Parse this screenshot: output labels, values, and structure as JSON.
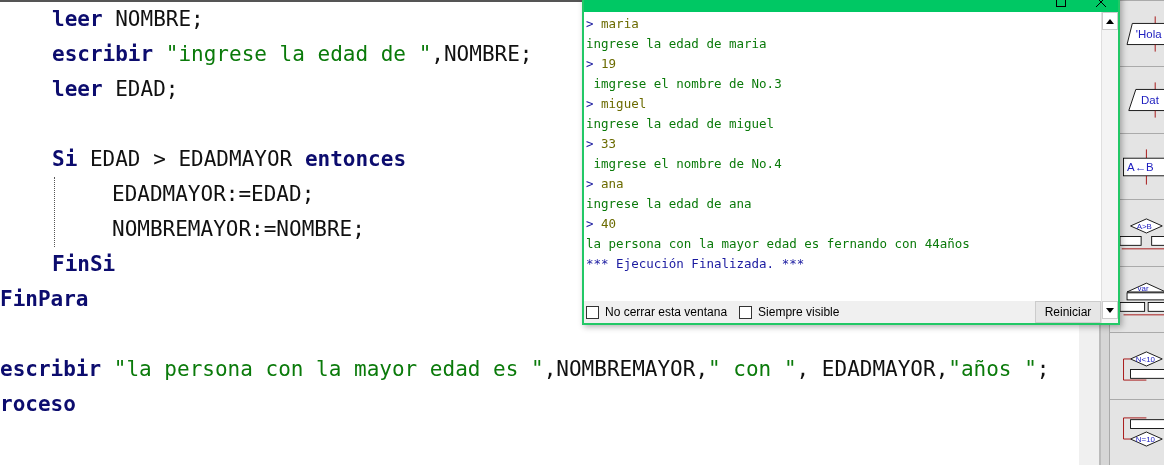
{
  "editor": {
    "lines": [
      {
        "children": [
          {
            "tokens": [
              {
                "kind": "keyword",
                "text": "leer"
              },
              {
                "kind": "plain",
                "text": " NOMBRE;"
              }
            ]
          },
          {
            "tokens": [
              {
                "kind": "keyword",
                "text": "escribir "
              },
              {
                "kind": "string",
                "text": "\"ingrese la edad de \""
              },
              {
                "kind": "plain",
                "text": ",NOMBRE;"
              }
            ]
          },
          {
            "tokens": [
              {
                "kind": "keyword",
                "text": "leer"
              },
              {
                "kind": "plain",
                "text": " EDAD;"
              }
            ]
          },
          {
            "blank_before": true,
            "tokens": [
              {
                "kind": "keyword",
                "text": "Si"
              },
              {
                "kind": "plain",
                "text": " EDAD > EDADMAYOR "
              },
              {
                "kind": "keyword",
                "text": "entonces"
              }
            ],
            "children": [
              {
                "tokens": [
                  {
                    "kind": "plain",
                    "text": "EDADMAYOR:=EDAD;"
                  }
                ]
              },
              {
                "tokens": [
                  {
                    "kind": "plain",
                    "text": "NOMBREMAYOR:=NOMBRE;"
                  }
                ]
              }
            ]
          },
          {
            "tokens": [
              {
                "kind": "keyword",
                "text": "FinSi"
              }
            ]
          }
        ]
      },
      {
        "tokens": [
          {
            "kind": "keyword",
            "text": "FinPara"
          }
        ]
      },
      {
        "blank_before": true,
        "tokens": [
          {
            "kind": "keyword",
            "text": "escribir "
          },
          {
            "kind": "string",
            "text": "\"la persona con la mayor edad es \""
          },
          {
            "kind": "plain",
            "text": ",NOMBREMAYOR,"
          },
          {
            "kind": "string",
            "text": "\" con \""
          },
          {
            "kind": "plain",
            "text": ", EDADMAYOR,"
          },
          {
            "kind": "string",
            "text": "\"años \""
          },
          {
            "kind": "plain",
            "text": ";"
          }
        ]
      },
      {
        "tokens": [
          {
            "kind": "keyword",
            "text": "roceso"
          }
        ]
      }
    ]
  },
  "console": {
    "lines": [
      {
        "kind": "input",
        "prompt": ">",
        "text": "maria"
      },
      {
        "kind": "output",
        "text": "ingrese la edad de maria"
      },
      {
        "kind": "input",
        "prompt": ">",
        "text": "19"
      },
      {
        "kind": "output",
        "text": " imgrese el nombre de No.3"
      },
      {
        "kind": "input",
        "prompt": ">",
        "text": "miguel"
      },
      {
        "kind": "output",
        "text": "ingrese la edad de miguel"
      },
      {
        "kind": "input",
        "prompt": ">",
        "text": "33"
      },
      {
        "kind": "output",
        "text": " imgrese el nombre de No.4"
      },
      {
        "kind": "input",
        "prompt": ">",
        "text": "ana"
      },
      {
        "kind": "output",
        "text": "ingrese la edad de ana"
      },
      {
        "kind": "input",
        "prompt": ">",
        "text": "40"
      },
      {
        "kind": "output",
        "text": "la persona con la mayor edad es fernando con 44años"
      },
      {
        "kind": "system",
        "text": "*** Ejecución Finalizada. ***"
      }
    ],
    "options": [
      {
        "label": "No cerrar esta ventana",
        "checked": false
      },
      {
        "label": "Siempre visible",
        "checked": false
      }
    ],
    "button": "Reiniciar"
  },
  "palette": [
    {
      "kind": "output",
      "label": "'Hola"
    },
    {
      "kind": "input",
      "label": "Dat"
    },
    {
      "kind": "assign",
      "label": "A←B"
    },
    {
      "kind": "if",
      "label": "A>B"
    },
    {
      "kind": "switch",
      "label": "var"
    },
    {
      "kind": "while",
      "label": "N<10"
    },
    {
      "kind": "repeat",
      "label": "N=10"
    }
  ]
}
